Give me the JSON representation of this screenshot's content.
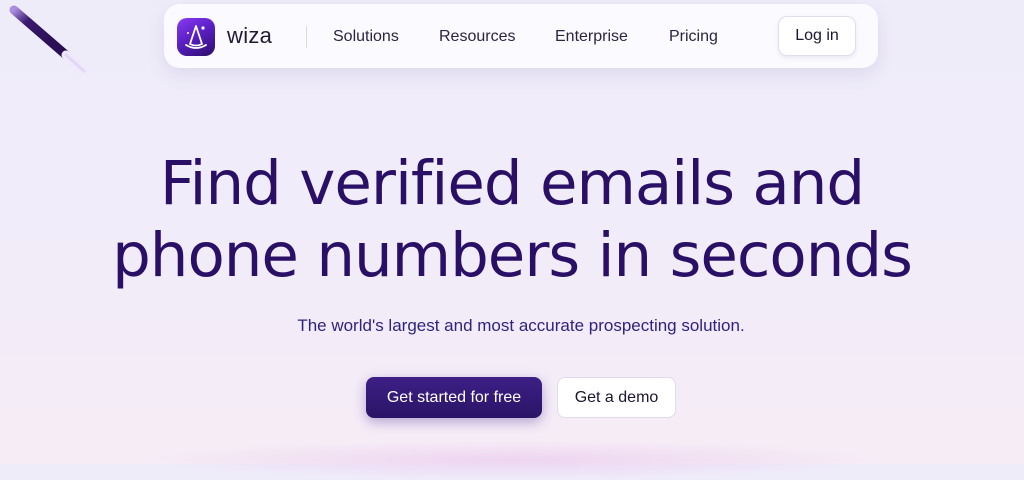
{
  "brand": {
    "name": "wiza",
    "accent_color": "#5b1fc7",
    "dark_color": "#2a0f66"
  },
  "nav": {
    "items": [
      {
        "label": "Solutions"
      },
      {
        "label": "Resources"
      },
      {
        "label": "Enterprise"
      },
      {
        "label": "Pricing"
      }
    ],
    "login_label": "Log in"
  },
  "hero": {
    "headline_line1": "Find verified emails and",
    "headline_line2": "phone numbers in seconds",
    "subtitle": "The world's largest and most accurate prospecting solution.",
    "primary_cta": "Get started for free",
    "secondary_cta": "Get a demo"
  },
  "decor": {
    "wand_icon": "magic-wand-icon",
    "logo_icon": "wizard-hat-icon"
  }
}
